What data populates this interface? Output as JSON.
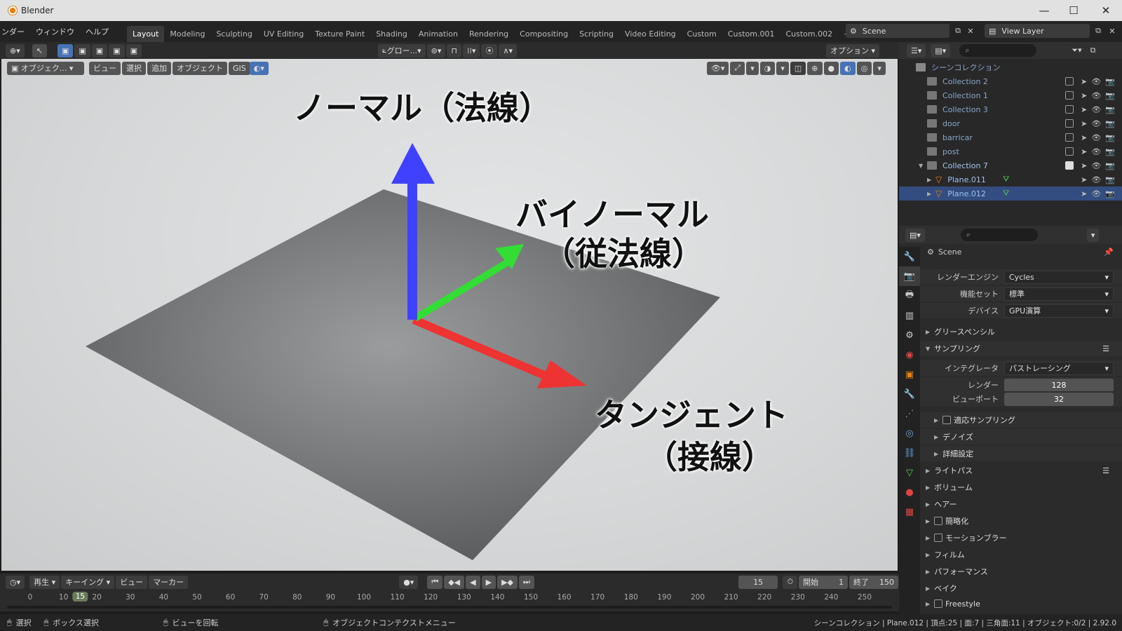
{
  "window": {
    "title": "Blender",
    "minimize": "—",
    "maximize": "☐",
    "close": "✕"
  },
  "menu": [
    "ンダー",
    "ウィンドウ",
    "ヘルプ"
  ],
  "workspaces": [
    "Layout",
    "Modeling",
    "Sculpting",
    "UV Editing",
    "Texture Paint",
    "Shading",
    "Animation",
    "Rendering",
    "Compositing",
    "Scripting",
    "Video Editing",
    "Custom",
    "Custom.001",
    "Custom.002",
    "+"
  ],
  "active_workspace": "Layout",
  "scene_selector": "Scene",
  "view_layer": "View Layer",
  "toolbar": {
    "transform_orient": "グロー...",
    "options": "オプション"
  },
  "viewport_header": {
    "mode": "オブジェク...",
    "view": "ビュー",
    "select": "選択",
    "add": "追加",
    "object": "オブジェクト",
    "gis": "GIS"
  },
  "annotations": {
    "normal": "ノーマル（法線）",
    "binormal_1": "バイノーマル",
    "binormal_2": "（従法線）",
    "tangent_1": "タンジェント",
    "tangent_2": "（接線）"
  },
  "axis_colors": {
    "normal": "#4040ff",
    "binormal": "#33dd33",
    "tangent": "#ee3333"
  },
  "outliner": {
    "root": "シーンコレクション",
    "items": [
      {
        "name": "Collection 2",
        "checked": false
      },
      {
        "name": "Collection 1",
        "checked": false
      },
      {
        "name": "Collection 3",
        "checked": false
      },
      {
        "name": "door",
        "checked": false
      },
      {
        "name": "barricar",
        "checked": false
      },
      {
        "name": "post",
        "checked": false
      },
      {
        "name": "Collection 7",
        "checked": true
      },
      {
        "name": "Plane.011"
      },
      {
        "name": "Plane.012"
      }
    ]
  },
  "properties": {
    "context": "Scene",
    "render_engine_label": "レンダーエンジン",
    "render_engine": "Cycles",
    "feature_set_label": "機能セット",
    "feature_set": "標準",
    "device_label": "デバイス",
    "device": "GPU演算",
    "grease_pencil": "グリースペンシル",
    "sampling": "サンプリング",
    "integrator_label": "インテグレータ",
    "integrator": "パストレーシング",
    "render_label": "レンダー",
    "render_samples": "128",
    "viewport_label": "ビューポート",
    "viewport_samples": "32",
    "adaptive_sampling": "適応サンプリング",
    "denoise": "デノイズ",
    "advanced": "詳細設定",
    "light_paths": "ライトパス",
    "volumes": "ボリューム",
    "hair": "ヘアー",
    "simplify": "簡略化",
    "motion_blur": "モーションブラー",
    "film": "フィルム",
    "performance": "パフォーマンス",
    "bake": "ベイク",
    "freestyle": "Freestyle"
  },
  "timeline": {
    "playback": "再生",
    "keying": "キーイング",
    "view": "ビュー",
    "marker": "マーカー",
    "current_frame": "15",
    "start_label": "開始",
    "start": "1",
    "end_label": "終了",
    "end": "150",
    "ruler": [
      "0",
      "10",
      "20",
      "30",
      "40",
      "50",
      "60",
      "70",
      "80",
      "90",
      "100",
      "110",
      "120",
      "130",
      "140",
      "150",
      "160",
      "170",
      "180",
      "190",
      "200",
      "210",
      "220",
      "230",
      "240",
      "250"
    ],
    "frame_marker": "15"
  },
  "statusbar": {
    "select": "選択",
    "box_select": "ボックス選択",
    "rotate_view": "ビューを回転",
    "context_menu": "オブジェクトコンテクストメニュー",
    "stats": "シーンコレクション | Plane.012 | 頂点:25 | 面:7 | 三角面:11 | オブジェクト:0/2 | 2.92.0"
  }
}
